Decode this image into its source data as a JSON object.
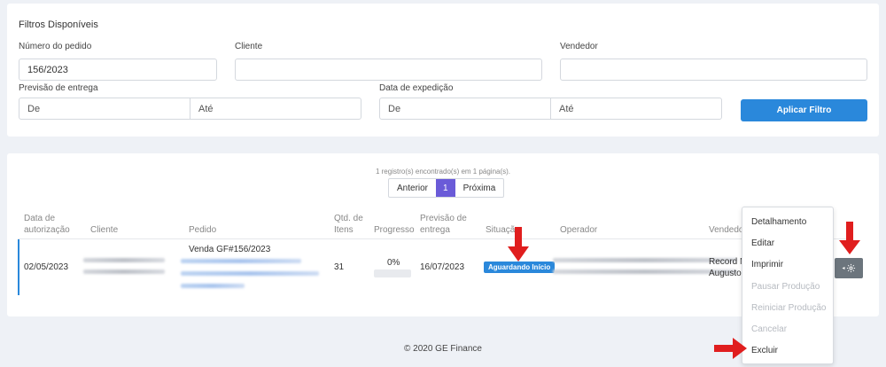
{
  "filters": {
    "title": "Filtros Disponíveis",
    "order_number_label": "Número do pedido",
    "order_number_value": "156/2023",
    "client_label": "Cliente",
    "client_value": "",
    "seller_label": "Vendedor",
    "seller_value": "",
    "delivery_label": "Previsão de entrega",
    "delivery_from": "De",
    "delivery_to": "Até",
    "dispatch_label": "Data de expedição",
    "dispatch_from": "De",
    "dispatch_to": "Até",
    "apply_label": "Aplicar Filtro"
  },
  "results": {
    "count_text": "1 registro(s) encontrado(s) em 1 página(s).",
    "pager": {
      "prev": "Anterior",
      "current": "1",
      "next": "Próxima"
    },
    "headers": {
      "auth_date_1": "Data de",
      "auth_date_2": "autorização",
      "client": "Cliente",
      "order": "Pedido",
      "qty_1": "Qtd. de",
      "qty_2": "Itens",
      "progress": "Progresso",
      "forecast_1": "Previsão de",
      "forecast_2": "entrega",
      "status": "Situação",
      "operator": "Operador",
      "seller": "Vendedor"
    },
    "row": {
      "auth_date": "02/05/2023",
      "order": "Venda GF#156/2023",
      "qty": "31",
      "progress": "0%",
      "progress_value": 0,
      "forecast": "16/07/2023",
      "status": "Aguardando Início",
      "seller_1": "Record M",
      "seller_2": "Augusto"
    }
  },
  "menu": {
    "items": [
      {
        "label": "Detalhamento",
        "enabled": true
      },
      {
        "label": "Editar",
        "enabled": true
      },
      {
        "label": "Imprimir",
        "enabled": true
      },
      {
        "label": "Pausar Produção",
        "enabled": false
      },
      {
        "label": "Reiniciar Produção",
        "enabled": false
      },
      {
        "label": "Cancelar",
        "enabled": false
      },
      {
        "label": "Excluir",
        "enabled": true
      }
    ]
  },
  "footer": {
    "text": "© 2020 GE Finance"
  },
  "colors": {
    "primary": "#2a88db",
    "pager_active": "#6a5bd8",
    "arrow": "#e01e1e",
    "gear_button": "#6c757d"
  },
  "icons": {
    "actions": "gear-icon",
    "annotation": "red-arrow-icon"
  }
}
